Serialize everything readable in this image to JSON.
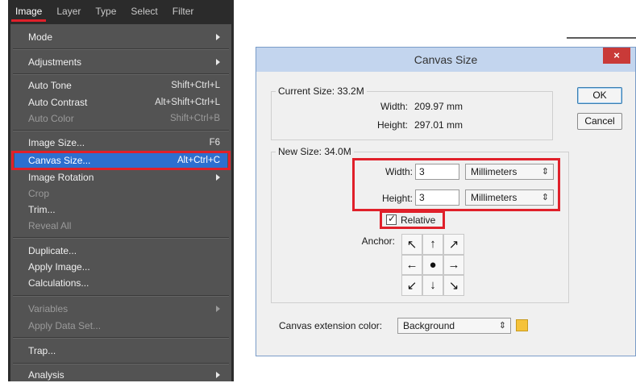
{
  "menubar": {
    "items": [
      "Image",
      "Layer",
      "Type",
      "Select",
      "Filter"
    ]
  },
  "menu": {
    "mode": "Mode",
    "adjustments": "Adjustments",
    "auto_tone": {
      "label": "Auto Tone",
      "shortcut": "Shift+Ctrl+L"
    },
    "auto_contrast": {
      "label": "Auto Contrast",
      "shortcut": "Alt+Shift+Ctrl+L"
    },
    "auto_color": {
      "label": "Auto Color",
      "shortcut": "Shift+Ctrl+B"
    },
    "image_size": {
      "label": "Image Size...",
      "shortcut": "F6"
    },
    "canvas_size": {
      "label": "Canvas Size...",
      "shortcut": "Alt+Ctrl+C"
    },
    "image_rotation": "Image Rotation",
    "crop": "Crop",
    "trim": "Trim...",
    "reveal_all": "Reveal All",
    "duplicate": "Duplicate...",
    "apply_image": "Apply Image...",
    "calculations": "Calculations...",
    "variables": "Variables",
    "apply_data_set": "Apply Data Set...",
    "trap": "Trap...",
    "analysis": "Analysis"
  },
  "dialog": {
    "title": "Canvas Size",
    "close": "×",
    "current_size": {
      "legend": "Current Size: 33.2M",
      "width_label": "Width:",
      "width_value": "209.97 mm",
      "height_label": "Height:",
      "height_value": "297.01 mm"
    },
    "new_size": {
      "legend": "New Size: 34.0M",
      "width_label": "Width:",
      "width_value": "3",
      "width_unit": "Millimeters",
      "height_label": "Height:",
      "height_value": "3",
      "height_unit": "Millimeters",
      "relative_label": "Relative",
      "relative_checked": true,
      "anchor_label": "Anchor:",
      "anchor_cells": [
        "↖",
        "↑",
        "↗",
        "←",
        "●",
        "→",
        "↙",
        "↓",
        "↘"
      ]
    },
    "extension_color_label": "Canvas extension color:",
    "extension_color_value": "Background",
    "extension_swatch_color": "#f5c23a",
    "ok": "OK",
    "cancel": "Cancel"
  },
  "colors": {
    "highlight": "#e0202a",
    "menu_selection": "#2d6fcf"
  }
}
